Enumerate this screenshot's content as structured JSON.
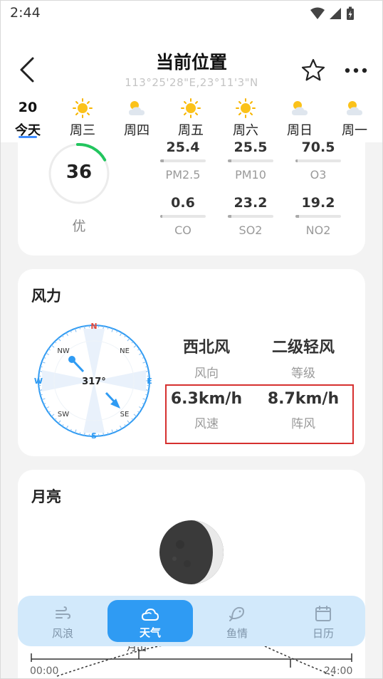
{
  "status": {
    "time": "2:44"
  },
  "header": {
    "title": "当前位置",
    "coords": "113°25'28\"E,23°11'3\"N"
  },
  "days": [
    {
      "num": "20",
      "label": "今天",
      "active": true,
      "icon": "none"
    },
    {
      "num": "",
      "label": "周三",
      "icon": "sun-icon"
    },
    {
      "num": "",
      "label": "周四",
      "icon": "partly-cloudy-icon"
    },
    {
      "num": "",
      "label": "周五",
      "icon": "sun-icon"
    },
    {
      "num": "",
      "label": "周六",
      "icon": "sun-icon"
    },
    {
      "num": "",
      "label": "周日",
      "icon": "partly-cloudy-icon"
    },
    {
      "num": "",
      "label": "周一",
      "icon": "partly-cloudy-icon"
    }
  ],
  "air_quality": {
    "aqi": "36",
    "level": "优",
    "level_color": "#22c55e",
    "aqi_fraction": 0.18,
    "pollutants": [
      {
        "value": "25.4",
        "name": "PM2.5",
        "fill": 0.08
      },
      {
        "value": "25.5",
        "name": "PM10",
        "fill": 0.08
      },
      {
        "value": "70.5",
        "name": "O3",
        "fill": 0.05
      },
      {
        "value": "0.6",
        "name": "CO",
        "fill": 0.05
      },
      {
        "value": "23.2",
        "name": "SO2",
        "fill": 0.08
      },
      {
        "value": "19.2",
        "name": "NO2",
        "fill": 0.08
      }
    ]
  },
  "wind": {
    "title": "风力",
    "compass": {
      "n": "N",
      "s": "S",
      "e": "E",
      "w": "W",
      "nw": "NW",
      "ne": "NE",
      "sw": "SW",
      "se": "SE",
      "degrees": "317°"
    },
    "direction": "西北风",
    "direction_label": "风向",
    "grade": "二级轻风",
    "grade_label": "等级",
    "speed": "6.3km/h",
    "speed_label": "风速",
    "gust": "8.7km/h",
    "gust_label": "阵风"
  },
  "moon": {
    "title": "月亮",
    "moonrise_label": "月出",
    "time_start": "00:00",
    "time_end": "24:00"
  },
  "nav": [
    {
      "label": "风浪",
      "icon": "wind-wave-icon"
    },
    {
      "label": "天气",
      "icon": "cloud-icon",
      "active": true
    },
    {
      "label": "鱼情",
      "icon": "fish-icon"
    },
    {
      "label": "日历",
      "icon": "calendar-icon"
    }
  ],
  "colors": {
    "accent": "#2f9bf3",
    "highlight": "#d6302f",
    "aqi_good": "#22c55e"
  }
}
